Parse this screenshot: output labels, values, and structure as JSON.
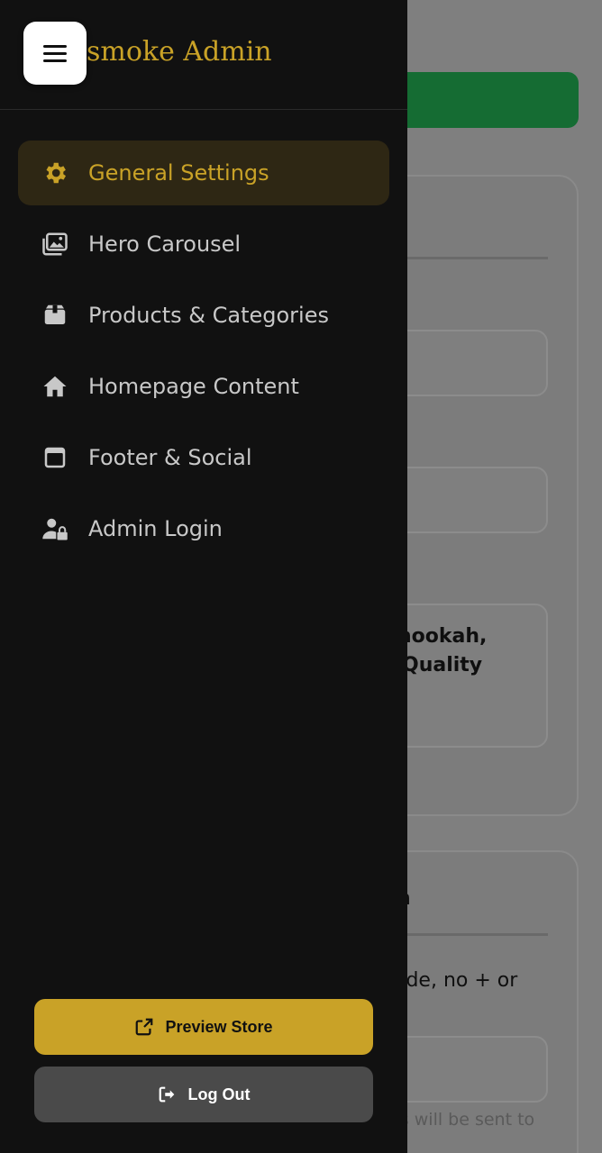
{
  "brand": {
    "title": "smoke Admin"
  },
  "nav": {
    "items": [
      {
        "label": "General Settings",
        "icon": "gear-icon",
        "active": true
      },
      {
        "label": "Hero Carousel",
        "icon": "images-icon",
        "active": false
      },
      {
        "label": "Products & Categories",
        "icon": "box-icon",
        "active": false
      },
      {
        "label": "Homepage Content",
        "icon": "home-icon",
        "active": false
      },
      {
        "label": "Footer & Social",
        "icon": "window-icon",
        "active": false
      },
      {
        "label": "Admin Login",
        "icon": "user-lock-icon",
        "active": false
      }
    ]
  },
  "actions": {
    "preview_label": "Preview Store",
    "logout_label": "Log Out"
  },
  "background": {
    "text1": "hookah,",
    "text2": "Quality",
    "text3": "n",
    "text4": "ode, no + or",
    "text5": "rs will be sent to"
  },
  "colors": {
    "accent": "#c9a227",
    "drawer_bg": "#111111",
    "active_bg": "#2e2714",
    "success_green": "#156c33"
  }
}
